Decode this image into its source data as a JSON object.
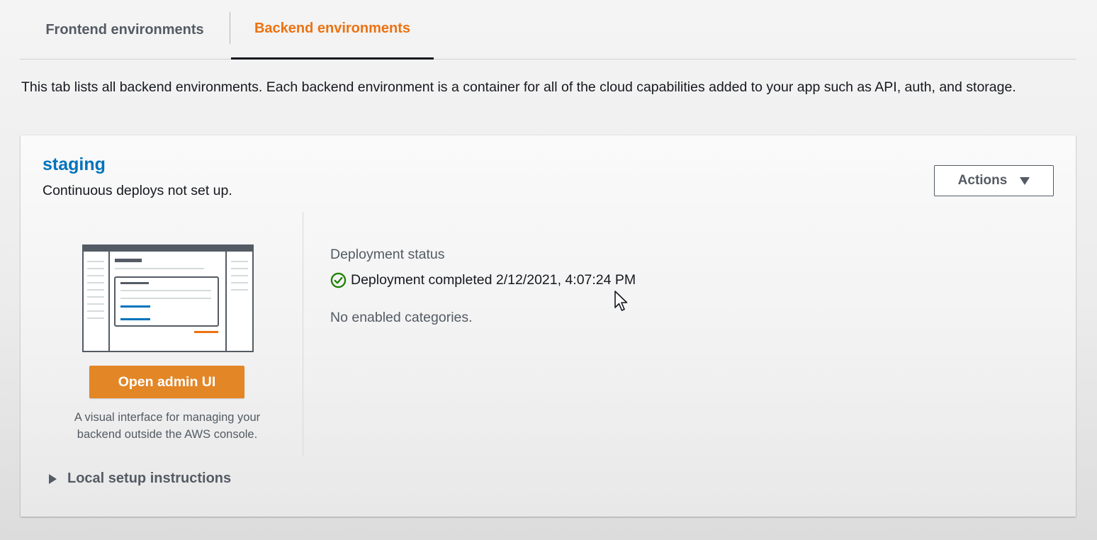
{
  "tabs": {
    "frontend_label": "Frontend environments",
    "backend_label": "Backend environments",
    "active": "Backend environments"
  },
  "intro_text": "This tab lists all backend environments. Each backend environment is a container for all of the cloud capabilities added to your app such as API, auth, and storage.",
  "environment": {
    "name": "staging",
    "subtitle": "Continuous deploys not set up.",
    "actions_label": "Actions",
    "admin": {
      "button_label": "Open admin UI",
      "description": "A visual interface for managing your backend outside the AWS console."
    },
    "deployment": {
      "status_label": "Deployment status",
      "status_text": "Deployment completed 2/12/2021, 4:07:24 PM",
      "categories_text": "No enabled categories."
    },
    "local_setup_label": "Local setup instructions"
  },
  "colors": {
    "accent": "#ec7211",
    "link": "#0073bb",
    "success": "#1d8102",
    "primary_button": "#e38626"
  },
  "icons": {
    "status": "check-circle-icon",
    "actions": "caret-down-icon",
    "local_setup": "caret-right-icon"
  }
}
